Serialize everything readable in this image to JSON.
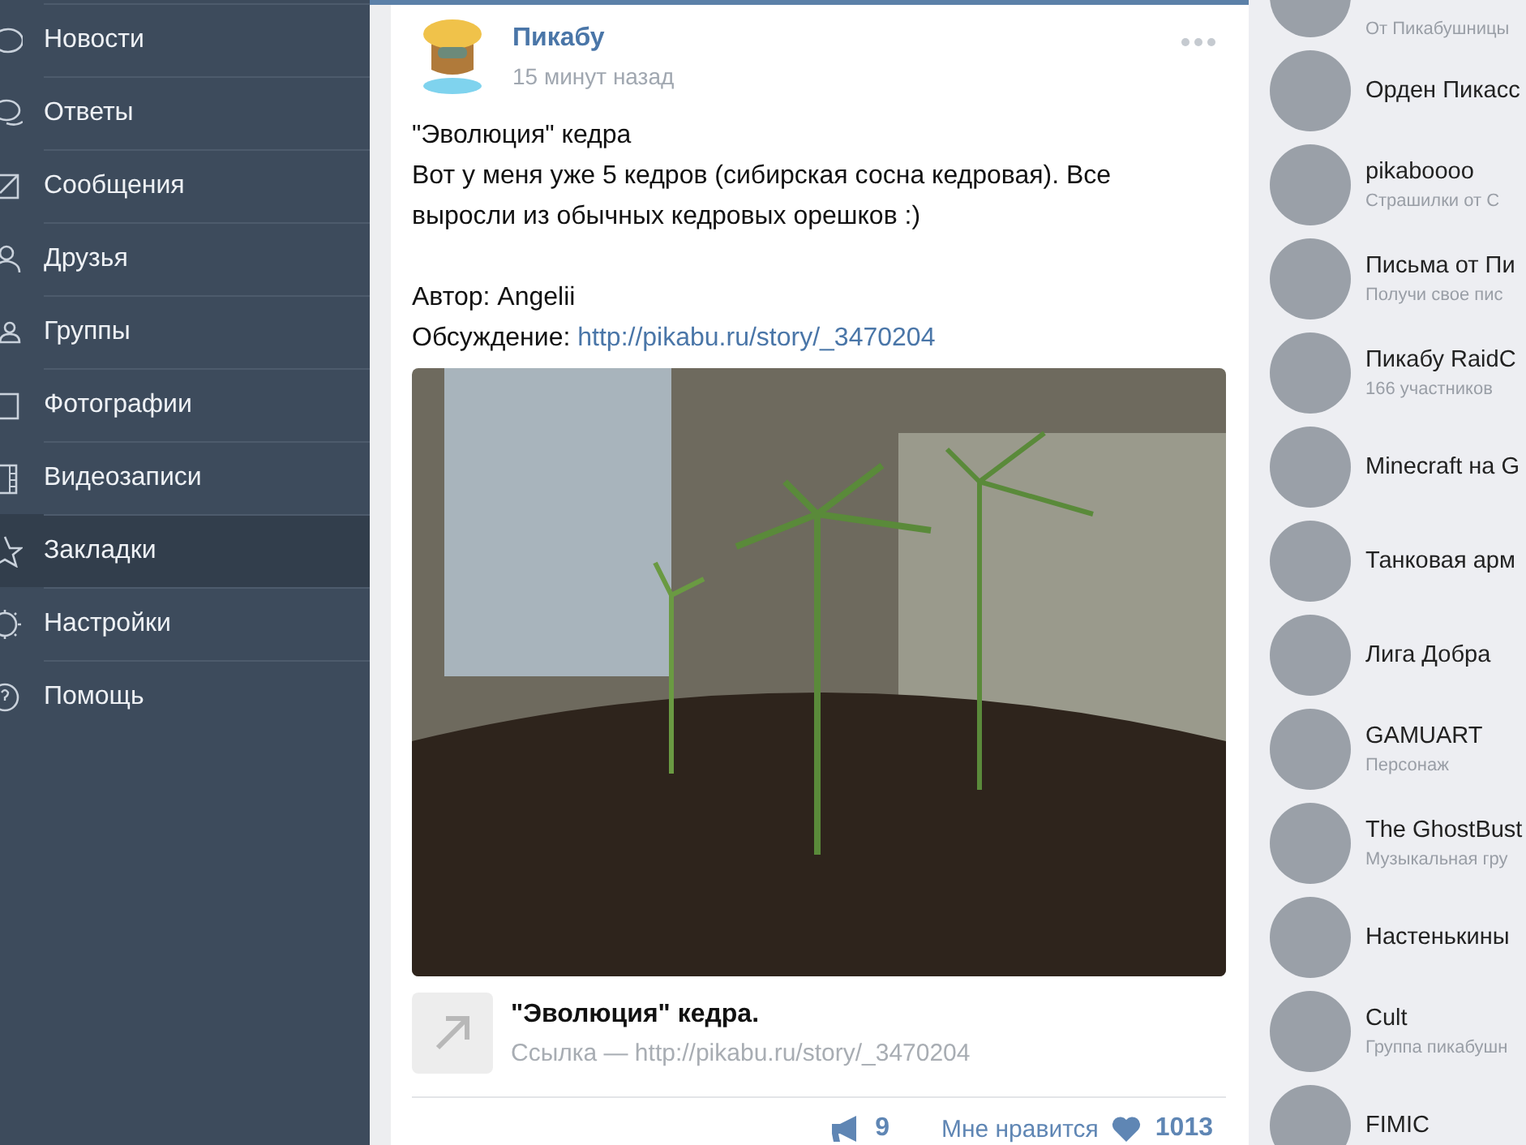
{
  "sidebar": {
    "items": [
      {
        "label": "Новости",
        "selected": false
      },
      {
        "label": "Ответы",
        "selected": false
      },
      {
        "label": "Сообщения",
        "selected": false
      },
      {
        "label": "Друзья",
        "selected": false
      },
      {
        "label": "Группы",
        "selected": false
      },
      {
        "label": "Фотографии",
        "selected": false
      },
      {
        "label": "Видеозаписи",
        "selected": false
      },
      {
        "label": "Закладки",
        "selected": true
      },
      {
        "label": "Настройки",
        "selected": false
      },
      {
        "label": "Помощь",
        "selected": false
      }
    ]
  },
  "post": {
    "author": "Пикабу",
    "time": "15 минут назад",
    "title": "\"Эволюция\" кедра",
    "body": "Вот у меня уже 5 кедров (сибирская сосна кедровая). Все выросли из обычных кедровых орешков :)",
    "author_line": "Автор: Angelii",
    "discussion_label": "Обсуждение:",
    "discussion_link": "http://pikabu.ru/story/_3470204",
    "attachment": {
      "title": "\"Эволюция\" кедра.",
      "subtitle": "Ссылка — http://pikabu.ru/story/_3470204"
    },
    "actions": {
      "shares": "9",
      "like_label": "Мне нравится",
      "likes": "1013"
    }
  },
  "groups": [
    {
      "subtitle": "От Пикабушницы"
    },
    {
      "name": "Орден Пикасс"
    },
    {
      "name": "pikaboooo",
      "subtitle": "Страшилки от С"
    },
    {
      "name": "Письма от Пи",
      "subtitle": "Получи свое пис"
    },
    {
      "name": "Пикабу RaidC",
      "subtitle": "166 участников"
    },
    {
      "name": "Minecraft на G"
    },
    {
      "name": "Танковая арм"
    },
    {
      "name": "Лига Добра"
    },
    {
      "name": "GAMUART",
      "subtitle": "Персонаж"
    },
    {
      "name": "The GhostBust",
      "subtitle": "Музыкальная гру"
    },
    {
      "name": "Настенькины"
    },
    {
      "name": "Cult",
      "subtitle": "Группа пикабушн"
    },
    {
      "name": "FIMIC"
    }
  ]
}
